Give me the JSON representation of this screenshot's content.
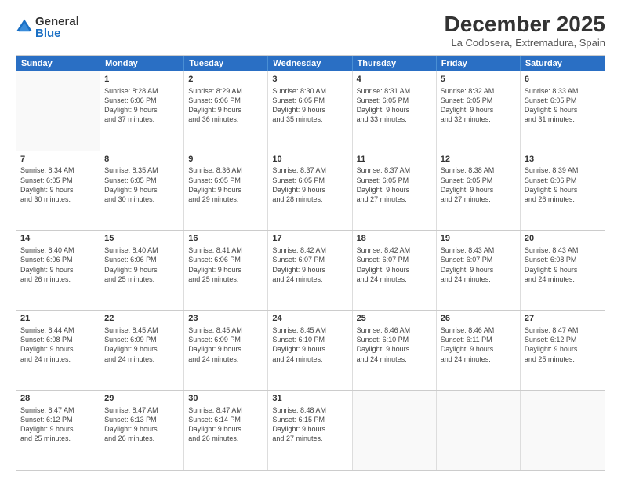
{
  "logo": {
    "general": "General",
    "blue": "Blue"
  },
  "title": "December 2025",
  "subtitle": "La Codosera, Extremadura, Spain",
  "header_days": [
    "Sunday",
    "Monday",
    "Tuesday",
    "Wednesday",
    "Thursday",
    "Friday",
    "Saturday"
  ],
  "weeks": [
    [
      {
        "day": "",
        "lines": []
      },
      {
        "day": "1",
        "lines": [
          "Sunrise: 8:28 AM",
          "Sunset: 6:06 PM",
          "Daylight: 9 hours",
          "and 37 minutes."
        ]
      },
      {
        "day": "2",
        "lines": [
          "Sunrise: 8:29 AM",
          "Sunset: 6:06 PM",
          "Daylight: 9 hours",
          "and 36 minutes."
        ]
      },
      {
        "day": "3",
        "lines": [
          "Sunrise: 8:30 AM",
          "Sunset: 6:05 PM",
          "Daylight: 9 hours",
          "and 35 minutes."
        ]
      },
      {
        "day": "4",
        "lines": [
          "Sunrise: 8:31 AM",
          "Sunset: 6:05 PM",
          "Daylight: 9 hours",
          "and 33 minutes."
        ]
      },
      {
        "day": "5",
        "lines": [
          "Sunrise: 8:32 AM",
          "Sunset: 6:05 PM",
          "Daylight: 9 hours",
          "and 32 minutes."
        ]
      },
      {
        "day": "6",
        "lines": [
          "Sunrise: 8:33 AM",
          "Sunset: 6:05 PM",
          "Daylight: 9 hours",
          "and 31 minutes."
        ]
      }
    ],
    [
      {
        "day": "7",
        "lines": [
          "Sunrise: 8:34 AM",
          "Sunset: 6:05 PM",
          "Daylight: 9 hours",
          "and 30 minutes."
        ]
      },
      {
        "day": "8",
        "lines": [
          "Sunrise: 8:35 AM",
          "Sunset: 6:05 PM",
          "Daylight: 9 hours",
          "and 30 minutes."
        ]
      },
      {
        "day": "9",
        "lines": [
          "Sunrise: 8:36 AM",
          "Sunset: 6:05 PM",
          "Daylight: 9 hours",
          "and 29 minutes."
        ]
      },
      {
        "day": "10",
        "lines": [
          "Sunrise: 8:37 AM",
          "Sunset: 6:05 PM",
          "Daylight: 9 hours",
          "and 28 minutes."
        ]
      },
      {
        "day": "11",
        "lines": [
          "Sunrise: 8:37 AM",
          "Sunset: 6:05 PM",
          "Daylight: 9 hours",
          "and 27 minutes."
        ]
      },
      {
        "day": "12",
        "lines": [
          "Sunrise: 8:38 AM",
          "Sunset: 6:05 PM",
          "Daylight: 9 hours",
          "and 27 minutes."
        ]
      },
      {
        "day": "13",
        "lines": [
          "Sunrise: 8:39 AM",
          "Sunset: 6:06 PM",
          "Daylight: 9 hours",
          "and 26 minutes."
        ]
      }
    ],
    [
      {
        "day": "14",
        "lines": [
          "Sunrise: 8:40 AM",
          "Sunset: 6:06 PM",
          "Daylight: 9 hours",
          "and 26 minutes."
        ]
      },
      {
        "day": "15",
        "lines": [
          "Sunrise: 8:40 AM",
          "Sunset: 6:06 PM",
          "Daylight: 9 hours",
          "and 25 minutes."
        ]
      },
      {
        "day": "16",
        "lines": [
          "Sunrise: 8:41 AM",
          "Sunset: 6:06 PM",
          "Daylight: 9 hours",
          "and 25 minutes."
        ]
      },
      {
        "day": "17",
        "lines": [
          "Sunrise: 8:42 AM",
          "Sunset: 6:07 PM",
          "Daylight: 9 hours",
          "and 24 minutes."
        ]
      },
      {
        "day": "18",
        "lines": [
          "Sunrise: 8:42 AM",
          "Sunset: 6:07 PM",
          "Daylight: 9 hours",
          "and 24 minutes."
        ]
      },
      {
        "day": "19",
        "lines": [
          "Sunrise: 8:43 AM",
          "Sunset: 6:07 PM",
          "Daylight: 9 hours",
          "and 24 minutes."
        ]
      },
      {
        "day": "20",
        "lines": [
          "Sunrise: 8:43 AM",
          "Sunset: 6:08 PM",
          "Daylight: 9 hours",
          "and 24 minutes."
        ]
      }
    ],
    [
      {
        "day": "21",
        "lines": [
          "Sunrise: 8:44 AM",
          "Sunset: 6:08 PM",
          "Daylight: 9 hours",
          "and 24 minutes."
        ]
      },
      {
        "day": "22",
        "lines": [
          "Sunrise: 8:45 AM",
          "Sunset: 6:09 PM",
          "Daylight: 9 hours",
          "and 24 minutes."
        ]
      },
      {
        "day": "23",
        "lines": [
          "Sunrise: 8:45 AM",
          "Sunset: 6:09 PM",
          "Daylight: 9 hours",
          "and 24 minutes."
        ]
      },
      {
        "day": "24",
        "lines": [
          "Sunrise: 8:45 AM",
          "Sunset: 6:10 PM",
          "Daylight: 9 hours",
          "and 24 minutes."
        ]
      },
      {
        "day": "25",
        "lines": [
          "Sunrise: 8:46 AM",
          "Sunset: 6:10 PM",
          "Daylight: 9 hours",
          "and 24 minutes."
        ]
      },
      {
        "day": "26",
        "lines": [
          "Sunrise: 8:46 AM",
          "Sunset: 6:11 PM",
          "Daylight: 9 hours",
          "and 24 minutes."
        ]
      },
      {
        "day": "27",
        "lines": [
          "Sunrise: 8:47 AM",
          "Sunset: 6:12 PM",
          "Daylight: 9 hours",
          "and 25 minutes."
        ]
      }
    ],
    [
      {
        "day": "28",
        "lines": [
          "Sunrise: 8:47 AM",
          "Sunset: 6:12 PM",
          "Daylight: 9 hours",
          "and 25 minutes."
        ]
      },
      {
        "day": "29",
        "lines": [
          "Sunrise: 8:47 AM",
          "Sunset: 6:13 PM",
          "Daylight: 9 hours",
          "and 26 minutes."
        ]
      },
      {
        "day": "30",
        "lines": [
          "Sunrise: 8:47 AM",
          "Sunset: 6:14 PM",
          "Daylight: 9 hours",
          "and 26 minutes."
        ]
      },
      {
        "day": "31",
        "lines": [
          "Sunrise: 8:48 AM",
          "Sunset: 6:15 PM",
          "Daylight: 9 hours",
          "and 27 minutes."
        ]
      },
      {
        "day": "",
        "lines": []
      },
      {
        "day": "",
        "lines": []
      },
      {
        "day": "",
        "lines": []
      }
    ]
  ]
}
